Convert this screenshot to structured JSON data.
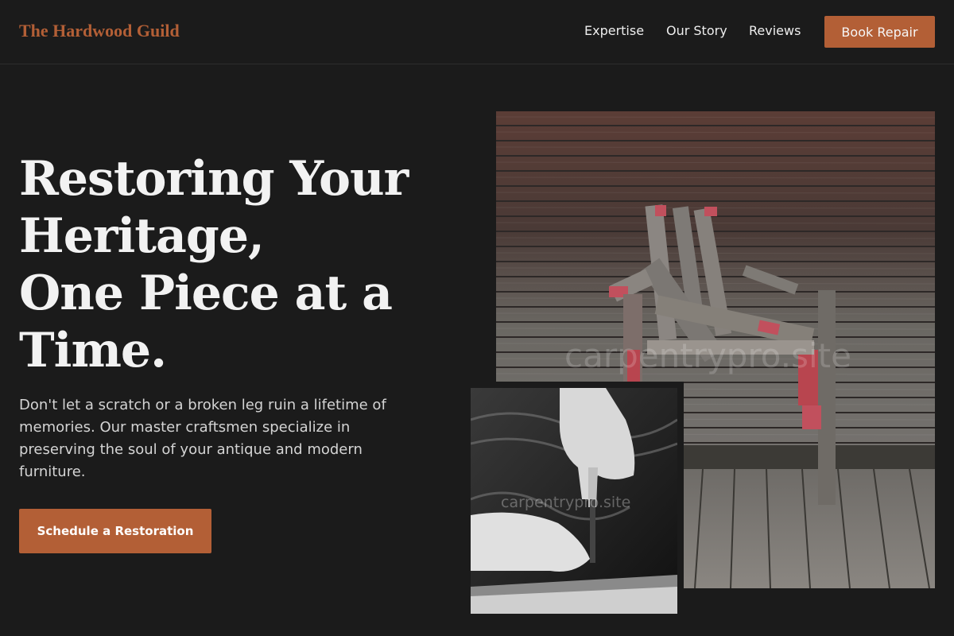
{
  "header": {
    "brand": "The Hardwood Guild",
    "nav": [
      "Expertise",
      "Our Story",
      "Reviews"
    ],
    "cta_label": "Book Repair"
  },
  "hero": {
    "headline_lines": [
      "Restoring Your",
      "Heritage,",
      "One Piece at a",
      "Time."
    ],
    "description": "Don't let a scratch or a broken leg ruin a lifetime of memories. Our master craftsmen specialize in preserving the soul of your antique and modern furniture.",
    "cta_label": "Schedule a Restoration"
  },
  "images": {
    "main_watermark": "carpentrypro.site",
    "inset_watermark": "carpentrypro.site"
  },
  "colors": {
    "accent": "#b35f36",
    "background": "#1b1b1b"
  }
}
